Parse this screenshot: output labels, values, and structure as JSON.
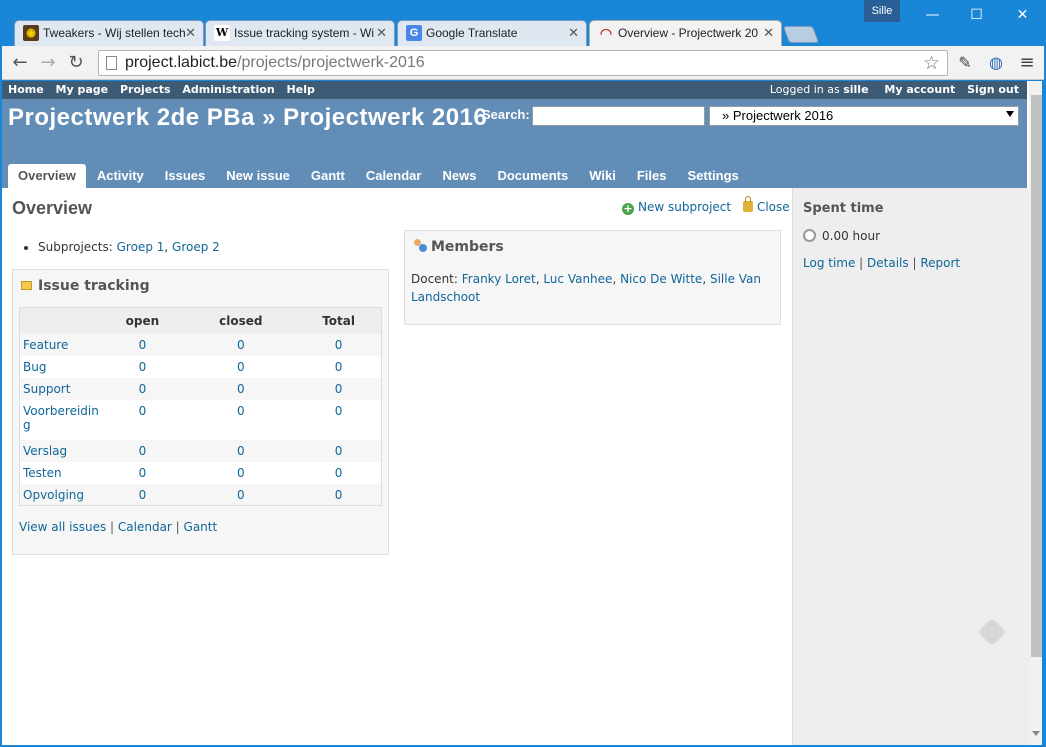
{
  "browser": {
    "profile_name": "Sille",
    "window_buttons": {
      "minimize": "—",
      "maximize": "☐",
      "close": "✕"
    },
    "tabs": [
      {
        "title": "Tweakers - Wij stellen tech",
        "icon": "tweakers-icon",
        "active": false
      },
      {
        "title": "Issue tracking system - Wi",
        "icon": "wikipedia-icon",
        "active": false
      },
      {
        "title": "Google Translate",
        "icon": "google-translate-icon",
        "active": false
      },
      {
        "title": "Overview - Projectwerk 20",
        "icon": "redmine-icon",
        "active": true
      }
    ],
    "address_bar": {
      "host": "project.labict.be",
      "path": "/projects/projectwerk-2016"
    }
  },
  "top_menu": {
    "left": [
      "Home",
      "My page",
      "Projects",
      "Administration",
      "Help"
    ],
    "logged_in_prefix": "Logged in as",
    "user": "sille",
    "right": [
      "My account",
      "Sign out"
    ]
  },
  "header": {
    "title": "Projectwerk 2de PBa » Projectwerk 2016",
    "search_label": "Search:",
    "search_value": "",
    "project_jump": "» Projectwerk 2016"
  },
  "main_menu": {
    "items": [
      "Overview",
      "Activity",
      "Issues",
      "New issue",
      "Gantt",
      "Calendar",
      "News",
      "Documents",
      "Wiki",
      "Files",
      "Settings"
    ],
    "selected": "Overview"
  },
  "content": {
    "title": "Overview",
    "contextual": {
      "new_subproject": "New subproject",
      "close": "Close"
    },
    "subprojects": {
      "label": "Subprojects:",
      "items": [
        "Groep 1",
        "Groep 2"
      ]
    },
    "issue_tracking": {
      "title": "Issue tracking",
      "columns": [
        "",
        "open",
        "closed",
        "Total"
      ],
      "rows": [
        {
          "tracker": "Feature",
          "open": "0",
          "closed": "0",
          "total": "0"
        },
        {
          "tracker": "Bug",
          "open": "0",
          "closed": "0",
          "total": "0"
        },
        {
          "tracker": "Support",
          "open": "0",
          "closed": "0",
          "total": "0"
        },
        {
          "tracker": "Voorbereiding",
          "open": "0",
          "closed": "0",
          "total": "0"
        },
        {
          "tracker": "Verslag",
          "open": "0",
          "closed": "0",
          "total": "0"
        },
        {
          "tracker": "Testen",
          "open": "0",
          "closed": "0",
          "total": "0"
        },
        {
          "tracker": "Opvolging",
          "open": "0",
          "closed": "0",
          "total": "0"
        }
      ],
      "links": [
        "View all issues",
        "Calendar",
        "Gantt"
      ]
    },
    "members": {
      "title": "Members",
      "role": "Docent:",
      "people": [
        "Franky Loret",
        "Luc Vanhee",
        "Nico De Witte",
        "Sille Van Landschoot"
      ]
    }
  },
  "sidebar": {
    "spent_time_title": "Spent time",
    "spent_time_value": "0.00 hour",
    "links": [
      "Log time",
      "Details",
      "Report"
    ]
  },
  "colors": {
    "header_bg": "#628db6",
    "top_menu_bg": "#3e5b76",
    "link": "#116699",
    "window_frame": "#1a86d8"
  }
}
